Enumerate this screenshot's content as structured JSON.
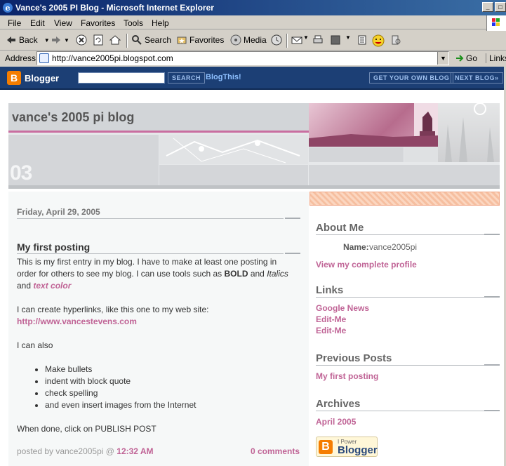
{
  "window": {
    "title": "Vance's 2005 PI Blog - Microsoft Internet Explorer",
    "minimize": "_",
    "maximize": "□"
  },
  "menu": [
    "File",
    "Edit",
    "View",
    "Favorites",
    "Tools",
    "Help"
  ],
  "toolbar": {
    "back": "Back",
    "search": "Search",
    "favorites": "Favorites",
    "media": "Media"
  },
  "address": {
    "label": "Address",
    "url": "http://vance2005pi.blogspot.com",
    "go": "Go",
    "links": "Links"
  },
  "navbar": {
    "brand": "Blogger",
    "search_button": "SEARCH",
    "blogthis": "BlogThis!",
    "get_own": "GET YOUR OWN BLOG",
    "next_blog": "NEXT BLOG»"
  },
  "blog": {
    "title": "vance's 2005 pi blog",
    "header_number": "03"
  },
  "post": {
    "date": "Friday, April 29, 2005",
    "title": "My first posting",
    "p1_a": "This is my first entry in my blog. I have to make at least one posting in order for others to see my blog. I can use tools such as ",
    "p1_bold": "BOLD",
    "p1_and": " and ",
    "p1_italic": "Italics",
    "p1_and2": "and ",
    "p1_color": "text color",
    "p2": "I can create hyperlinks, like this one to my web site:",
    "p2_link": "http://www.vancestevens.com",
    "p3": "I can also",
    "bullets": [
      "Make bullets",
      "indent with block quote",
      "check spelling",
      "and even insert images from the Internet"
    ],
    "p4": "When done, click on PUBLISH POST",
    "posted_by": "posted by vance2005pi @ ",
    "time": "12:32 AM",
    "comments": "0 comments"
  },
  "sidebar": {
    "about_head": "About Me",
    "name_label": "Name:",
    "name_value": "vance2005pi",
    "profile_link": "View my complete profile",
    "links_head": "Links",
    "links": [
      "Google News",
      "Edit-Me",
      "Edit-Me"
    ],
    "prev_head": "Previous Posts",
    "prev_posts": [
      "My first posting"
    ],
    "archives_head": "Archives",
    "archives": [
      "April 2005"
    ],
    "badge_small": "I Power",
    "badge_big": "Blogger"
  },
  "colors": {
    "accent_pink": "#c06496",
    "navbar_blue": "#1c3f75",
    "title_bar": "#0a246a"
  }
}
